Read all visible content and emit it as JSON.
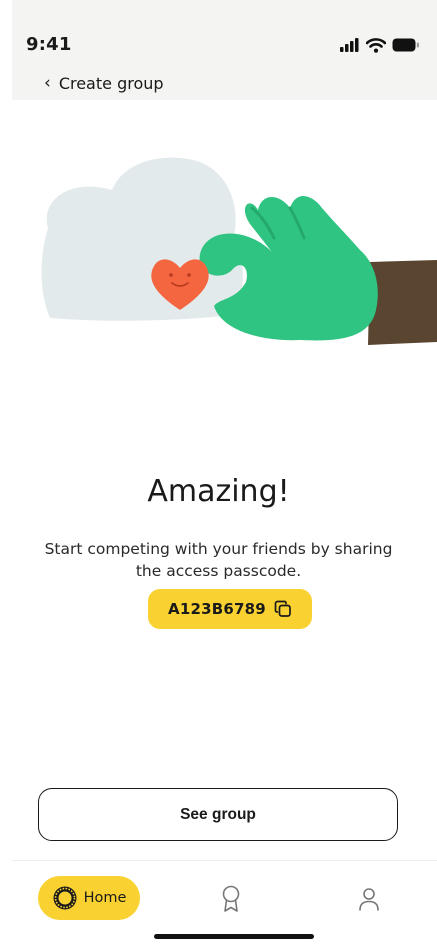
{
  "status_bar": {
    "time": "9:41"
  },
  "nav": {
    "back_icon": "chevron-left-icon",
    "title": "Create group"
  },
  "content": {
    "headline": "Amazing!",
    "subtitle": "Start competing with your friends by sharing the access passcode.",
    "passcode": "A123B6789",
    "copy_icon": "copy-icon"
  },
  "actions": {
    "see_group": "See group"
  },
  "tab_bar": {
    "home_label": "Home",
    "tabs": [
      {
        "icon": "sun-icon",
        "label": "Home",
        "active": true
      },
      {
        "icon": "award-icon",
        "active": false
      },
      {
        "icon": "user-icon",
        "active": false
      }
    ]
  },
  "colors": {
    "accent_yellow": "#f9d232",
    "glove_green": "#2fc482",
    "heart_orange": "#f4663f",
    "cloud": "#e3eaec",
    "skin": "#5a4530"
  }
}
